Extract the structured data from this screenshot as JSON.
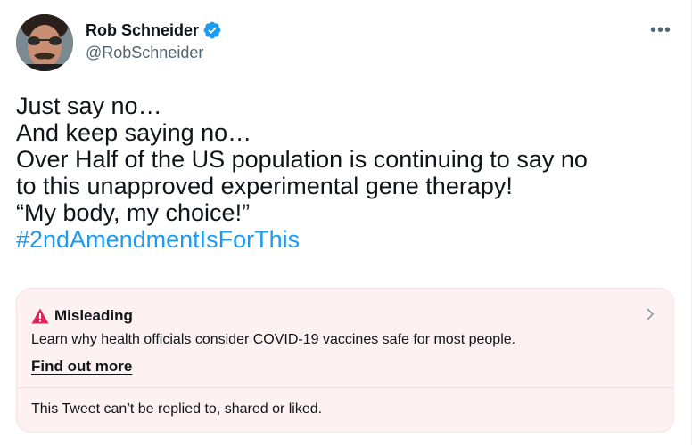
{
  "author": {
    "display_name": "Rob Schneider",
    "handle": "@RobSchneider",
    "verified": true,
    "verified_color": "#1d9bf0"
  },
  "menu": {
    "more_icon": "ellipsis-icon",
    "more_label": "•••"
  },
  "tweet": {
    "lines": [
      "Just say no…",
      "And keep saying no…",
      "Over Half of the US population is continuing to say no",
      "to this unapproved experimental gene therapy!",
      "“My body, my choice!”"
    ],
    "hashtag": "#2ndAmendmentIsForThis",
    "hashtag_color": "#1d9bf0"
  },
  "notice": {
    "label": "Misleading",
    "warning_icon": "warning-triangle-icon",
    "warning_color": "#e0245e",
    "description": "Learn why health officials consider COVID-19 vaccines safe for most people.",
    "link_label": "Find out more",
    "restriction": "This Tweet can’t be replied to, shared or liked.",
    "background": "#fdf1f2"
  }
}
